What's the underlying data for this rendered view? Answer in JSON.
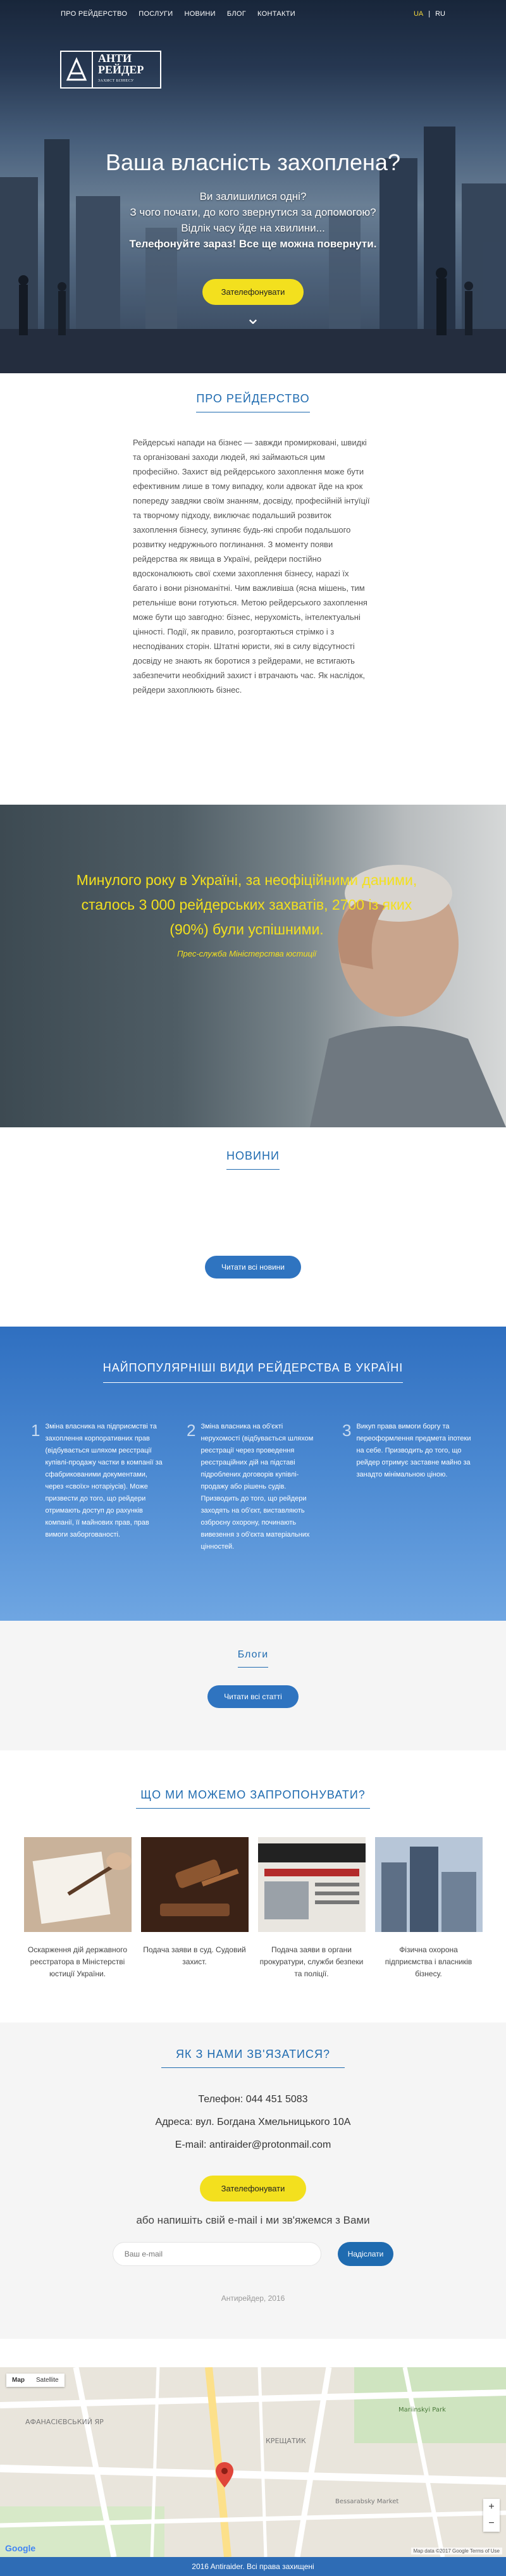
{
  "nav": {
    "links": [
      "ПРО РЕЙДЕРСТВО",
      "ПОСЛУГИ",
      "НОВИНИ",
      "БЛОГ",
      "КОНТАКТИ"
    ],
    "lang_active": "UA",
    "lang_separator": "|",
    "lang_other": "RU"
  },
  "logo": {
    "line1": "АНТИ",
    "line2": "РЕЙДЕР",
    "tagline": "ЗАХИСТ БІЗНЕСУ"
  },
  "hero": {
    "title": "Ваша власність захоплена?",
    "lines": [
      "Ви залишилися одні?",
      "З чого почати, до кого звернутися за допомогою?",
      "Відлік часу йде на хвилини..."
    ],
    "strong_line": "Телефонуйте зараз! Все ще можна повернути.",
    "cta": "Зателефонувати",
    "arrow": "⌄"
  },
  "about": {
    "title": "ПРО РЕЙДЕРСТВО",
    "text": "Рейдерські напади на бізнес — завжди промирковані, швидкі та організовані заходи людей, які займаються цим професійно. Захист від рейдерського захоплення може бути ефективним лише в тому випадку, коли адвокат йде на крок попереду завдяки своїм знанням, досвіду, професійній інтуїції та творчому підходу, виключає подальший розвиток захоплення бізнесу, зупиняє будь-які спроби подальшого розвитку недружнього поглинання. З моменту появи рейдерства як явища в Україні, рейдери постійно вдосконалюють свої схеми захоплення бізнесу, нарazi їх багато і вони різноманітні. Чим важливіша (ясна мішень, тим ретельніше вони готуються. Метою рейдерського захоплення може бути що завгодно: бізнес, нерухомість, інтелектуальні цінності. Події, як правило, розгортаються стрімко і з несподіваних сторін. Штатні юристи, які в силу відсутності досвіду не знають як боротися з рейдерами, не встигають забезпечити необхідний захист і втрачають час. Як наслідок, рейдери захоплюють бізнес."
  },
  "band": {
    "quote": "Минулого року в Україні, за неофіційними даними, сталось 3 000 рейдерських захватів, 2700 із яких (90%) були успішними.",
    "source": "Прес-служба Міністерства юстиції"
  },
  "news": {
    "title": "НОВИНИ",
    "button": "Читати всі новини"
  },
  "types": {
    "title": "НАЙПОПУЛЯРНІШІ ВИДИ РЕЙДЕРСТВА В УКРАЇНІ",
    "items": [
      {
        "num": "1",
        "text": "Зміна власника на підприємстві та захоплення корпоративних прав (відбувається шляхом реєстрації купівлі-продажу частки в компанії за сфабрикованими документами, через «своїх» нотаріусів). Може призвести до того, що рейдери отримають доступ до рахунків компанії, її майнових прав, прав вимоги заборгованості."
      },
      {
        "num": "2",
        "text": "Зміна власника на об'єкті нерухомості (відбувається шляхом реєстрації через проведення реєстраційних дій на підставі підроблених договорів купівлі-продажу або рішень судів. Призводить до того, що рейдери заходять на об'єкт, виставляють озброєну охорону, починають вивезення з об'єкта матеріальних цінностей."
      },
      {
        "num": "3",
        "text": "Викуп права вимоги боргу та переоформлення предмета іпотеки на себе. Призводить до того, що рейдер отримує заставне майно за занадто мінімальною ціною."
      }
    ]
  },
  "blogs": {
    "title": "Блоги",
    "button": "Читати всі статті"
  },
  "offers": {
    "title": "ЩО МИ МОЖЕМО ЗАПРОПОНУВАТИ?",
    "cards": [
      {
        "caption": "Оскарження дій державного реєстратора в Міністерстві юстиції України."
      },
      {
        "caption": "Подача заяви в суд. Судовий захист."
      },
      {
        "caption": "Подача заяви в органи прокуратури, служби безпеки та поліції."
      },
      {
        "caption": "Фізична охорона підприємства і власників бізнесу."
      }
    ]
  },
  "contact": {
    "title": "ЯК З НАМИ ЗВ'ЯЗАТИСЯ?",
    "phone": "Телефон: 044 451 5083",
    "address": "Адреса: вул. Богдана Хмельницького 10А",
    "email": "E-mail: antiraider@protonmail.com",
    "cta": "Зателефонувати",
    "or": "або напишіть свій e-mail і ми зв'яжемся з Вами",
    "input_placeholder": "Ваш e-mail",
    "send": "Надіслати",
    "soft_copy": "Антирейдер, 2016"
  },
  "map": {
    "type_map": "Map",
    "type_sat": "Satellite",
    "zoom_in": "+",
    "zoom_out": "−",
    "google": "Google",
    "terms": "Map data ©2017 Google   Terms of Use",
    "labels": [
      "АФАНАСІЄВСЬКИЙ ЯР",
      "КРЕЩАТИК",
      "Mariinskyi Park",
      "Bessarabsky Market"
    ]
  },
  "footer": {
    "text": "2016 Antiraider. Всі права захищені"
  }
}
